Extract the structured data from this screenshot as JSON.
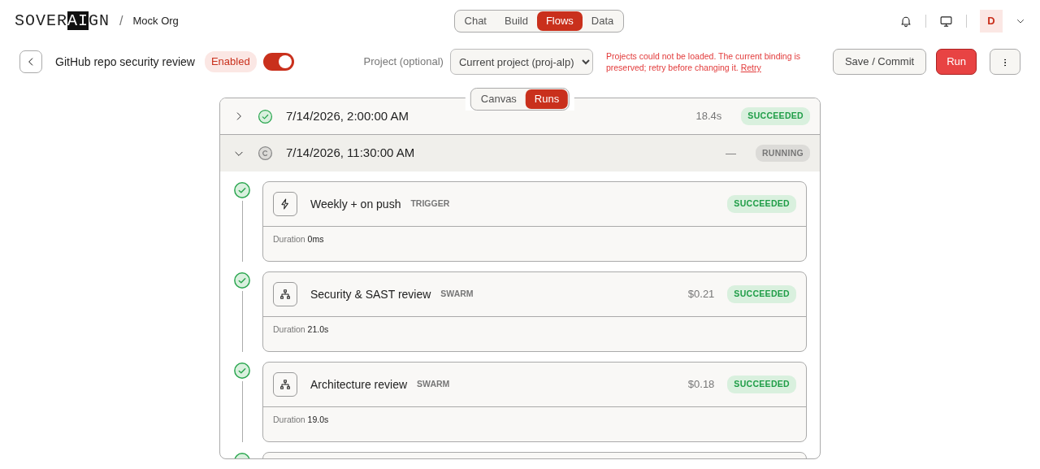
{
  "header": {
    "logo": [
      {
        "text": "SOVER",
        "inverted": false
      },
      {
        "text": "AI",
        "inverted": true
      },
      {
        "text": "GN",
        "inverted": false
      }
    ],
    "separator": "/",
    "org": "Mock Org",
    "nav": [
      {
        "label": "Chat",
        "selected": false
      },
      {
        "label": "Build",
        "selected": false
      },
      {
        "label": "Flows",
        "selected": true
      },
      {
        "label": "Data",
        "selected": false
      }
    ],
    "avatar": "D"
  },
  "toolbar": {
    "title": "GitHub repo security review",
    "status_badge": "Enabled",
    "enabled": true,
    "project_label": "Project (optional)",
    "project_value": "Current project (proj-alp)",
    "error": "Projects could not be loaded. The current binding is preserved; retry before changing it.",
    "retry": "Retry",
    "save": "Save / Commit",
    "run": "Run"
  },
  "view_tabs": [
    {
      "label": "Canvas",
      "selected": false
    },
    {
      "label": "Runs",
      "selected": true
    }
  ],
  "runs": [
    {
      "time": "7/14/2026, 2:00:00 AM",
      "running": false,
      "duration": "18.4s",
      "badge": "SUCCEEDED",
      "expanded": false
    },
    {
      "time": "7/14/2026, 11:30:00 AM",
      "running": true,
      "duration": "—",
      "badge": "RUNNING",
      "expanded": true,
      "steps": [
        {
          "kind": "trigger",
          "running": false,
          "title": "Weekly + on push",
          "type": "TRIGGER",
          "badge": "SUCCEEDED",
          "duration_label": "Duration",
          "duration": "0ms"
        },
        {
          "kind": "swarm",
          "running": false,
          "title": "Security & SAST review",
          "type": "SWARM",
          "cost": "$0.21",
          "badge": "SUCCEEDED",
          "duration_label": "Duration",
          "duration": "21.0s"
        },
        {
          "kind": "swarm",
          "running": false,
          "title": "Architecture review",
          "type": "SWARM",
          "cost": "$0.18",
          "badge": "SUCCEEDED",
          "duration_label": "Duration",
          "duration": "19.0s"
        },
        {
          "running": false
        }
      ]
    }
  ]
}
